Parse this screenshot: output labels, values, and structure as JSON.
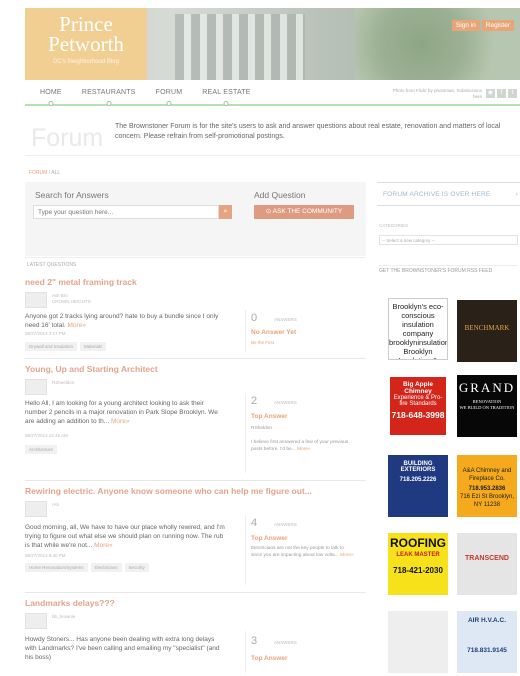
{
  "site": {
    "logo_line1": "Prince",
    "logo_line2": "Petworth",
    "tagline": "DC's Neighborhood Blog",
    "sign_in": "Sign in",
    "register": "Register",
    "photo_credit": "Photo from Flickr by photoman, Submissions here"
  },
  "nav": {
    "items": [
      "HOME",
      "RESTAURANTS",
      "FORUM",
      "REAL ESTATE"
    ]
  },
  "forum": {
    "title": "Forum",
    "description": "The Brownstoner Forum is for the site's users to ask and answer questions about real estate, renovation and matters of local concern. Please refrain from self-promotional postings.",
    "breadcrumb_root": "FORUM",
    "breadcrumb_rest": " / ALL"
  },
  "search": {
    "label": "Search for Answers",
    "placeholder": "Type your question here...",
    "ask_label": "Add Question",
    "ask_button": "ASK THE COMMUNITY"
  },
  "latest": {
    "header": "LATEST QUESTIONS",
    "answers_label": "ANSWERS",
    "more": "More»",
    "questions": [
      {
        "title": "need 2\" metal framing track",
        "user": "Ask Bro\nCROWN HEIGHTS",
        "body": "Anyone got 2 tracks lying around? hate to buy a bundle since I only need 16' total.",
        "date": "06/27/2013 3:17 PM",
        "tags": [
          "Drywall and Insulation",
          "Materials"
        ],
        "answers": "0",
        "status": "No Answer Yet",
        "status2": "Be the First",
        "snippet": ""
      },
      {
        "title": "Young, Up and Starting Architect",
        "user": "RSheeldon",
        "body": "Hello All, I am looking for a young architect looking to ask their number 2 pencils in a major renovation in Park Slope Brooklyn. We are adding an addition to th...",
        "date": "06/27/2013 12:45 AM",
        "tags": [
          "Architecture"
        ],
        "answers": "2",
        "status": "Top Answer",
        "status2": "",
        "snippet": "RSheldon\n\nI believe first answered a few of your previous posts before. I'd be..."
      },
      {
        "title": "Rewiring electric. Anyone know someone who can help me figure out...",
        "user": "rAh",
        "body": "Good morning, all, We have to have our place wholly rewired, and I'm trying to figure out what else we should plan on running now. The rub is that while we're not...",
        "date": "06/27/2013 8:40 PM",
        "tags": [
          "Home Renovation/Systems",
          "Electricians",
          "Security"
        ],
        "answers": "4",
        "status": "Top Answer",
        "status2": "",
        "snippet": "Electricians are not the key people to talk to since you are impacting about low volta..."
      },
      {
        "title": "Landmarks delays???",
        "user": "bb_brownie",
        "body": "Howdy Stoners... Has anyone been dealing with extra long delays with Landmarks? I've been calling and emailing my \"specialist\" (and his boss)",
        "date": "",
        "tags": [],
        "answers": "3",
        "status": "Top Answer",
        "status2": "",
        "snippet": ""
      }
    ]
  },
  "sidebar": {
    "archive_link": "FORUM ARCHIVE IS OVER HERE",
    "categories_label": "CATEGORIES",
    "categories_select": "-- Select a new category --",
    "rss": "GET THE BROWNSTONER'S FORUM RSS FEED",
    "ads": {
      "ad1": "Brooklyn's eco-conscious insulation company\nbrooklyninsulation.com\nBrooklyn Insulation & Soundproofing",
      "ad2": "BENCHMARK",
      "ad3_title": "Big Apple Chimney",
      "ad3_sub": "Experience & Pro-fire Standards",
      "ad3_phone": "718-648-3998",
      "ad4_big": "GRAND",
      "ad4_sm": "RENOVATION\nWE BUILD ON TRADITION",
      "ad5": "BUILDING EXTERIORS",
      "ad5_phone": "718.205.2226",
      "ad6": "A&A Chimney and Fireplace Co.",
      "ad6_phone": "718.953.2836",
      "ad6_addr": "716 Ezi St Brooklyn, NY 11238",
      "ad7": "ROOFING",
      "ad7_sub": "LEAK MASTER",
      "ad7_phone": "718-421-2030",
      "ad8": "TRANSCEND",
      "ad10": "AIR H.V.A.C.",
      "ad10_phone": "718.831.9145"
    }
  }
}
